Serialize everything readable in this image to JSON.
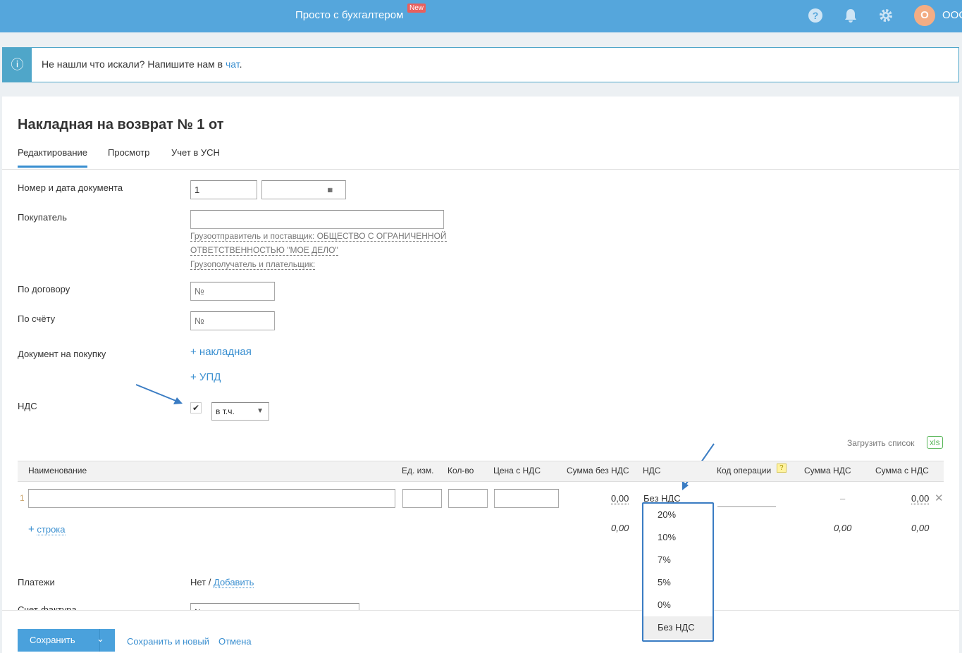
{
  "header": {
    "title": "Просто с бухгалтером",
    "badge": "New",
    "avatar_letter": "О",
    "org": "ООО",
    "icons": [
      "help-icon",
      "bell-icon",
      "gear-icon"
    ]
  },
  "banner": {
    "text": "Не нашли что искали? Напишите нам в ",
    "link": "чат",
    "suffix": "."
  },
  "page": {
    "title": "Накладная на возврат № 1 от",
    "tabs": [
      {
        "label": "Редактирование",
        "active": true
      },
      {
        "label": "Просмотр"
      },
      {
        "label": "Учет в УСН"
      }
    ]
  },
  "form": {
    "doc_label": "Номер и дата документа",
    "doc_number": "1",
    "doc_date": "",
    "buyer_label": "Покупатель",
    "buyer_value": "",
    "shipper": "Грузоотправитель и поставщик: ОБЩЕСТВО С ОГРАНИЧЕННОЙ",
    "shipper2": "ОТВЕТСТВЕННОСТЬЮ \"МОЕ ДЕЛО\"",
    "consignee": "Грузополучатель и плательщик:",
    "contract_label": "По договору",
    "contract_placeholder": "№",
    "invoice_label": "По счёту",
    "invoice_placeholder": "№",
    "purchase_label": "Документ на покупку",
    "add_waybill": "+ накладная",
    "add_upd": "+ УПД",
    "vat_label": "НДС",
    "vat_checked": true,
    "vat_mode": "в т.ч."
  },
  "table": {
    "upload": "Загрузить список",
    "xls": "xls",
    "headers": [
      "Наименование",
      "Ед. изм.",
      "Кол-во",
      "Цена с НДС",
      "Сумма без НДС",
      "НДС",
      "Код операции",
      "Сумма НДС",
      "Сумма с НДС"
    ],
    "help": "?",
    "row": {
      "n": "1",
      "sum_no_vat": "0,00",
      "vat": "Без НДС",
      "vat_sum": "–",
      "sum_vat": "0,00"
    },
    "add_row": "строка",
    "totals": {
      "sum_no_vat": "0,00",
      "vat_sum": "0,00",
      "sum_vat": "0,00"
    }
  },
  "vat_options": [
    "20%",
    "10%",
    "7%",
    "5%",
    "0%",
    "Без НДС"
  ],
  "vat_selected": "Без НДС",
  "payments": {
    "label": "Платежи",
    "none": "Нет /",
    "add": "Добавить"
  },
  "invoice_doc": {
    "label": "Счет-фактура",
    "placeholder": "№"
  },
  "footer": {
    "save": "Сохранить",
    "save_new": "Сохранить и новый",
    "cancel": "Отмена"
  }
}
